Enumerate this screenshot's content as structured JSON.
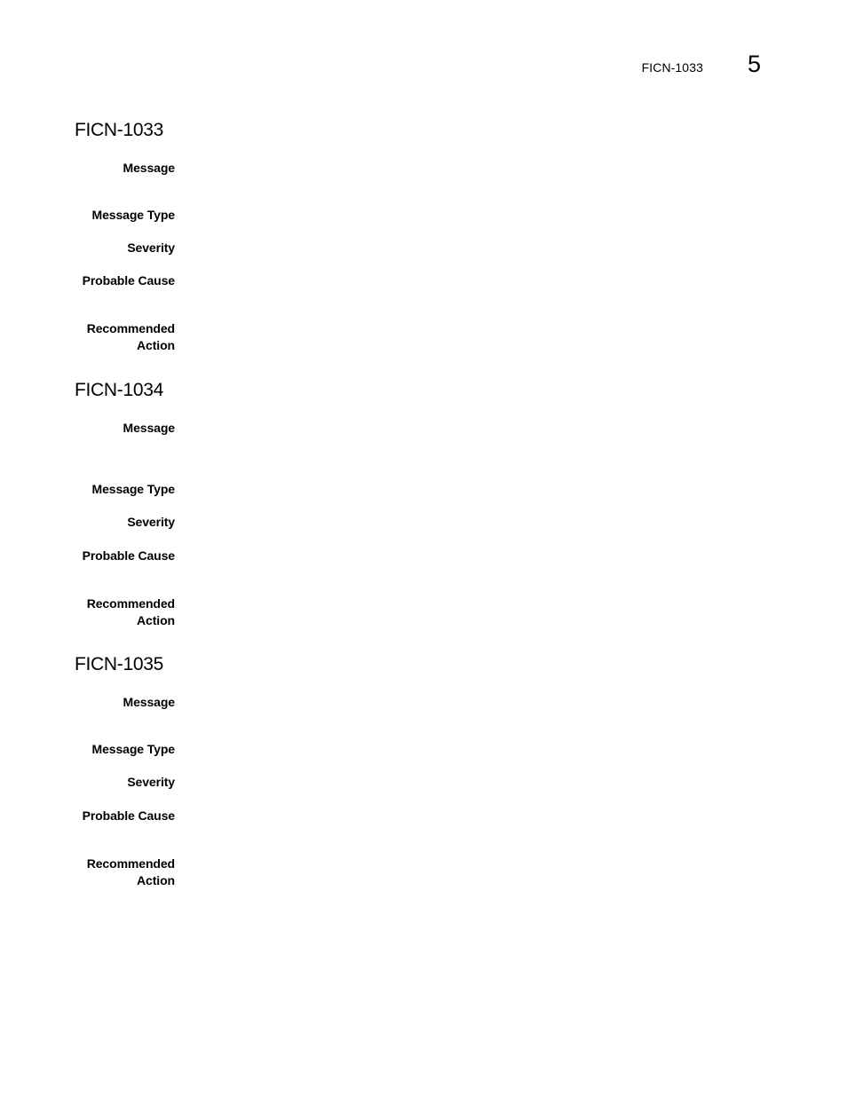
{
  "header": {
    "running_title": "FICN-1033",
    "chapter_number": "5"
  },
  "entries": [
    {
      "id": "FICN-1033",
      "fields": {
        "message_label": "Message",
        "message_type_label": "Message Type",
        "severity_label": "Severity",
        "probable_cause_label": "Probable Cause",
        "recommended_label_line1": "Recommended",
        "recommended_label_line2": "Action"
      }
    },
    {
      "id": "FICN-1034",
      "fields": {
        "message_label": "Message",
        "message_type_label": "Message Type",
        "severity_label": "Severity",
        "probable_cause_label": "Probable Cause",
        "recommended_label_line1": "Recommended",
        "recommended_label_line2": "Action"
      }
    },
    {
      "id": "FICN-1035",
      "fields": {
        "message_label": "Message",
        "message_type_label": "Message Type",
        "severity_label": "Severity",
        "probable_cause_label": "Probable Cause",
        "recommended_label_line1": "Recommended",
        "recommended_label_line2": "Action"
      }
    }
  ]
}
